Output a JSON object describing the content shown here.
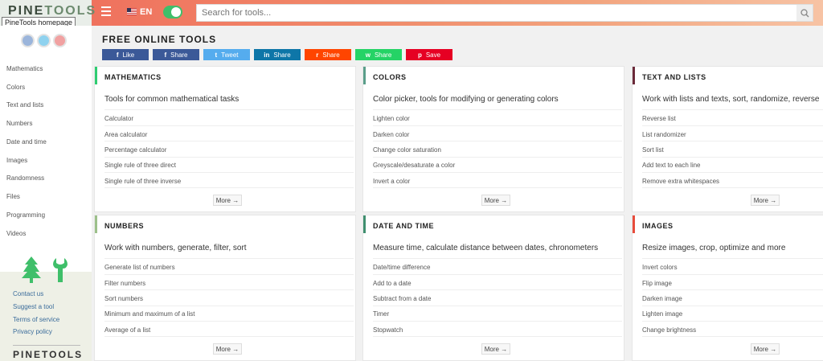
{
  "header": {
    "logo": "PINE",
    "logo_sub": "TOOLS",
    "tooltip": "PineTools homepage",
    "lang": "EN",
    "search_placeholder": "Search for tools..."
  },
  "sidebar": {
    "items": [
      {
        "label": "Mathematics"
      },
      {
        "label": "Colors"
      },
      {
        "label": "Text and lists"
      },
      {
        "label": "Numbers"
      },
      {
        "label": "Date and time"
      },
      {
        "label": "Images"
      },
      {
        "label": "Randomness"
      },
      {
        "label": "Files"
      },
      {
        "label": "Programming"
      },
      {
        "label": "Videos"
      }
    ],
    "footer_links": [
      {
        "label": "Contact us"
      },
      {
        "label": "Suggest a tool"
      },
      {
        "label": "Terms of service"
      },
      {
        "label": "Privacy policy"
      }
    ],
    "footer_logo": "PINE",
    "footer_logo_sub": "TOOLS"
  },
  "main": {
    "title": "FREE ONLINE TOOLS",
    "share": [
      {
        "icon": "f",
        "label": "Like",
        "color": "#3b5998"
      },
      {
        "icon": "f",
        "label": "Share",
        "color": "#3b5998"
      },
      {
        "icon": "t",
        "label": "Tweet",
        "color": "#55acee"
      },
      {
        "icon": "in",
        "label": "Share",
        "color": "#0e76a8"
      },
      {
        "icon": "r",
        "label": "Share",
        "color": "#ff4500"
      },
      {
        "icon": "w",
        "label": "Share",
        "color": "#25d366"
      },
      {
        "icon": "p",
        "label": "Save",
        "color": "#e60023"
      }
    ],
    "cards": [
      {
        "title": "MATHEMATICS",
        "accent": "#2ecc71",
        "desc": "Tools for common mathematical tasks",
        "items": [
          "Calculator",
          "Area calculator",
          "Percentage calculator",
          "Single rule of three direct",
          "Single rule of three inverse"
        ],
        "more": "More →"
      },
      {
        "title": "COLORS",
        "accent": "#5a9e8a",
        "desc": "Color picker, tools for modifying or generating colors",
        "items": [
          "Lighten color",
          "Darken color",
          "Change color saturation",
          "Greyscale/desaturate a color",
          "Invert a color"
        ],
        "more": "More →"
      },
      {
        "title": "TEXT AND LISTS",
        "accent": "#6b2a3a",
        "desc": "Work with lists and texts, sort, randomize, reverse",
        "items": [
          "Reverse list",
          "List randomizer",
          "Sort list",
          "Add text to each line",
          "Remove extra whitespaces"
        ],
        "more": "More →"
      },
      {
        "title": "NUMBERS",
        "accent": "#9cc08a",
        "desc": "Work with numbers, generate, filter, sort",
        "items": [
          "Generate list of numbers",
          "Filter numbers",
          "Sort numbers",
          "Minimum and maximum of a list",
          "Average of a list"
        ],
        "more": "More →"
      },
      {
        "title": "DATE AND TIME",
        "accent": "#3f8f6f",
        "desc": "Measure time, calculate distance between dates, chronometers",
        "items": [
          "Date/time difference",
          "Add to a date",
          "Subtract from a date",
          "Timer",
          "Stopwatch"
        ],
        "more": "More →"
      },
      {
        "title": "IMAGES",
        "accent": "#e74c3c",
        "desc": "Resize images, crop, optimize and more",
        "items": [
          "Invert colors",
          "Flip image",
          "Darken image",
          "Lighten image",
          "Change brightness"
        ],
        "more": "More →"
      }
    ]
  }
}
